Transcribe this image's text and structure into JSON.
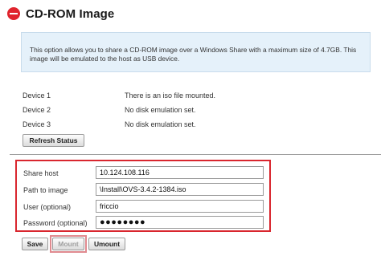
{
  "header": {
    "title": "CD-ROM Image",
    "icon": "no-entry-icon",
    "icon_color": "#e0242d"
  },
  "info": {
    "text": "This option allows you to share a CD-ROM image over a Windows Share with a maximum size of 4.7GB. This image will be emulated to the host as USB device."
  },
  "devices": [
    {
      "label": "Device 1",
      "status": "There is an iso file mounted."
    },
    {
      "label": "Device 2",
      "status": "No disk emulation set."
    },
    {
      "label": "Device 3",
      "status": "No disk emulation set."
    }
  ],
  "refresh_label": "Refresh Status",
  "form": {
    "share_host": {
      "label": "Share host",
      "value": "10.124.108.116"
    },
    "path": {
      "label": "Path to image",
      "value": "\\Install\\OVS-3.4.2-1384.iso"
    },
    "user": {
      "label": "User (optional)",
      "value": "friccio"
    },
    "password": {
      "label": "Password (optional)",
      "value": "●●●●●●●●"
    }
  },
  "buttons": {
    "save": "Save",
    "mount": "Mount",
    "umount": "Umount"
  },
  "highlight_color": "#d9262e"
}
